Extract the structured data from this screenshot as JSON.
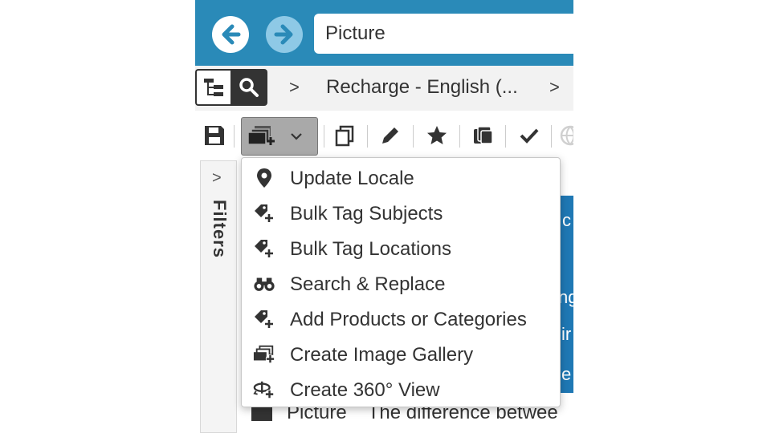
{
  "search": {
    "value": "Picture"
  },
  "breadcrumb": {
    "separator": ">",
    "text": "Recharge - English (..."
  },
  "filters": {
    "chevron": ">",
    "label": "Filters"
  },
  "menu": {
    "items": [
      {
        "label": "Update Locale",
        "icon": "map-pin-icon"
      },
      {
        "label": "Bulk Tag Subjects",
        "icon": "tag-add-icon"
      },
      {
        "label": "Bulk Tag Locations",
        "icon": "tag-add-icon"
      },
      {
        "label": "Search & Replace",
        "icon": "binoculars-icon"
      },
      {
        "label": "Add Products or Categories",
        "icon": "tag-add-icon"
      },
      {
        "label": "Create Image Gallery",
        "icon": "gallery-add-icon"
      },
      {
        "label": "Create 360° View",
        "icon": "rotate-360-icon"
      }
    ]
  },
  "background": {
    "partial_letters": [
      "c",
      "ng",
      "ir",
      "e"
    ],
    "row": {
      "type": "Picture",
      "description": "The difference betwee"
    }
  },
  "colors": {
    "topbar": "#2a8ab8",
    "highlight_blue": "#1f78b4",
    "batch_button": "#a9a9a9"
  }
}
